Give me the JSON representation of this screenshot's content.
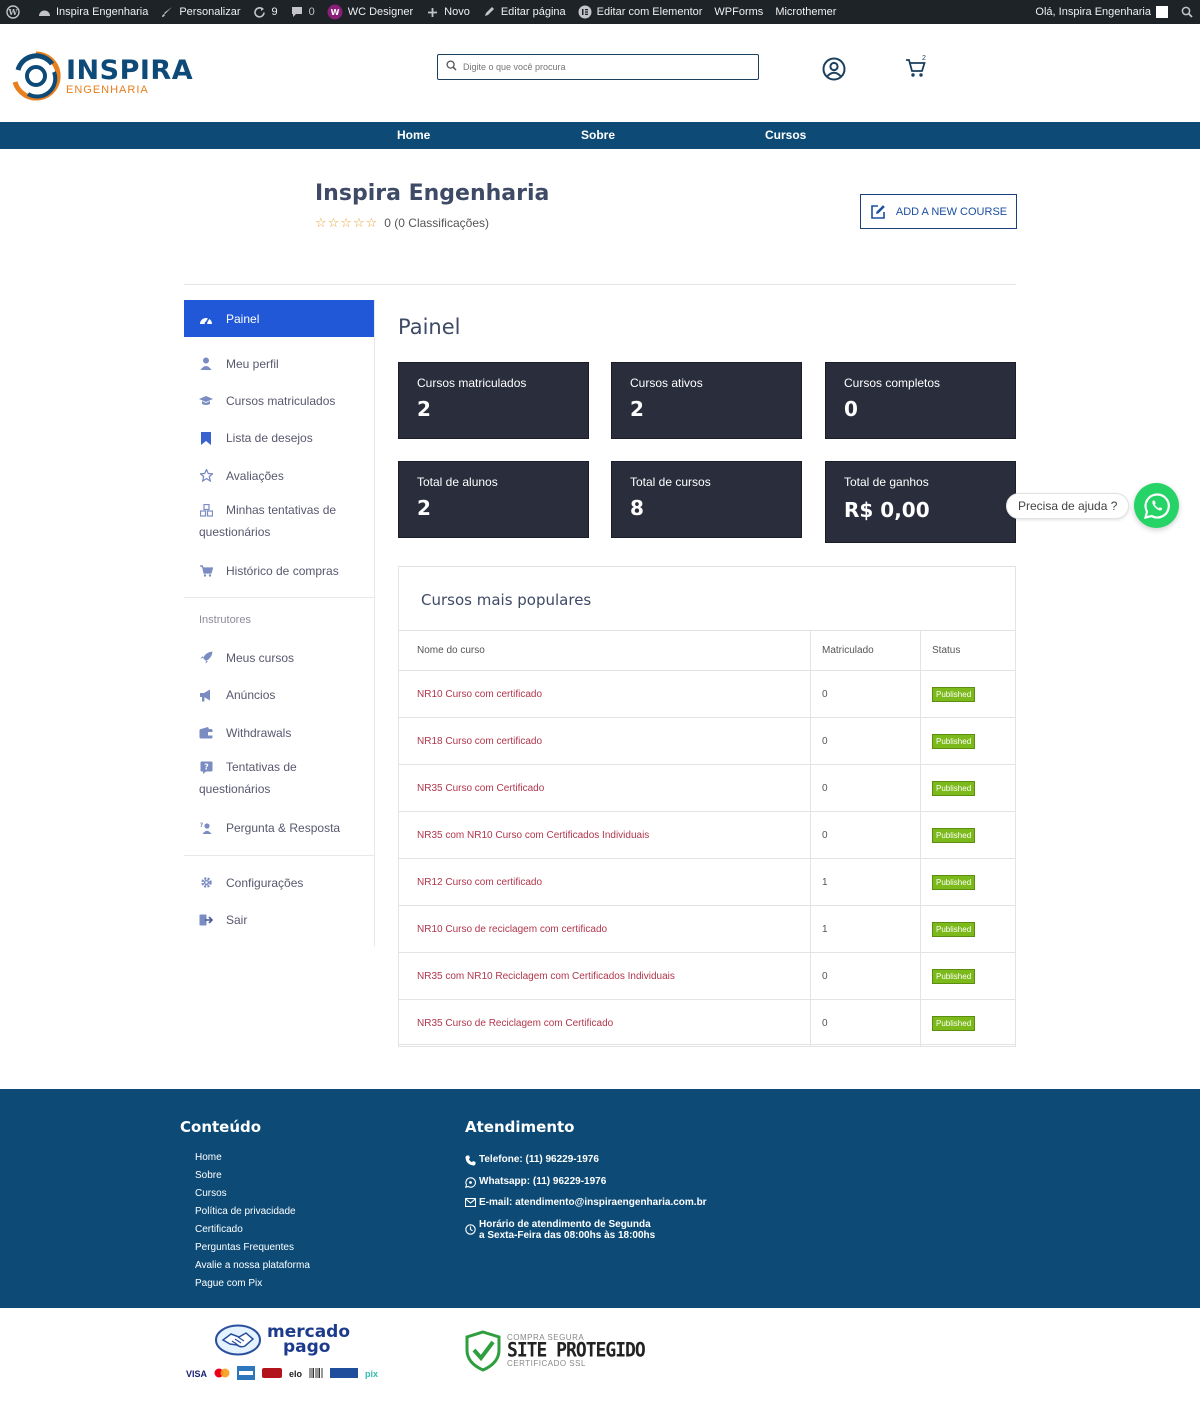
{
  "adminbar": {
    "items": [
      "Inspira Engenharia",
      "Personalizar",
      "9",
      "0",
      "WC Designer",
      "Novo",
      "Editar página",
      "Editar com Elementor",
      "WPForms",
      "Microthemer"
    ],
    "greeting": "Olá, Inspira Engenharia"
  },
  "header": {
    "logo_main": "INSPIRA",
    "logo_sub": "ENGENHARIA",
    "search_placeholder": "Digite o que você procura",
    "cart_count": "2"
  },
  "nav": {
    "items": [
      "Home",
      "Sobre",
      "Cursos"
    ]
  },
  "profile": {
    "name": "Inspira Engenharia",
    "rating_text": "0 (0 Classificações)",
    "add_course": "ADD A NEW COURSE"
  },
  "sidebar": {
    "items": [
      "Painel",
      "Meu perfil",
      "Cursos matriculados",
      "Lista de desejos",
      "Avaliações",
      "Minhas tentativas de",
      "questionários",
      "Histórico de compras"
    ],
    "instructor_heading": "Instrutores",
    "instructor_items": [
      "Meus cursos",
      "Anúncios",
      "Withdrawals",
      "Tentativas de",
      "questionários",
      "Pergunta & Resposta"
    ],
    "bottom_items": [
      "Configurações",
      "Sair"
    ]
  },
  "dashboard": {
    "title": "Painel",
    "cards": [
      {
        "label": "Cursos matriculados",
        "value": "2"
      },
      {
        "label": "Cursos ativos",
        "value": "2"
      },
      {
        "label": "Cursos completos",
        "value": "0"
      },
      {
        "label": "Total de alunos",
        "value": "2"
      },
      {
        "label": "Total de cursos",
        "value": "8"
      },
      {
        "label": "Total de ganhos",
        "value": "R$ 0,00"
      }
    ]
  },
  "popular": {
    "title": "Cursos mais populares",
    "headers": [
      "Nome do curso",
      "Matriculado",
      "Status"
    ],
    "rows": [
      {
        "name": "NR10 Curso com certificado",
        "enrolled": "0",
        "status": "Published"
      },
      {
        "name": "NR18 Curso com certificado",
        "enrolled": "0",
        "status": "Published"
      },
      {
        "name": "NR35 Curso com Certificado",
        "enrolled": "0",
        "status": "Published"
      },
      {
        "name": "NR35 com NR10 Curso com Certificados Individuais",
        "enrolled": "0",
        "status": "Published"
      },
      {
        "name": "NR12 Curso com certificado",
        "enrolled": "1",
        "status": "Published"
      },
      {
        "name": "NR10 Curso de reciclagem com certificado",
        "enrolled": "1",
        "status": "Published"
      },
      {
        "name": "NR35 com NR10 Reciclagem com Certificados Individuais",
        "enrolled": "0",
        "status": "Published"
      },
      {
        "name": "NR35 Curso de Reciclagem com Certificado",
        "enrolled": "0",
        "status": "Published"
      }
    ]
  },
  "whatsapp": {
    "help": "Precisa de ajuda ?"
  },
  "footer": {
    "content_heading": "Conteúdo",
    "links": [
      "Home",
      "Sobre",
      "Cursos",
      "Política de privacidade",
      "Certificado",
      "Perguntas Frequentes",
      "Avalie a nossa plataforma",
      "Pague com Pix"
    ],
    "service_heading": "Atendimento",
    "phone": "Telefone: (11) 96229-1976",
    "whatsapp": "Whatsapp: (11) 96229-1976",
    "email": "E-mail: atendimento@inspiraengenharia.com.br",
    "hours_1": "Horário de atendimento de Segunda",
    "hours_2": "a Sexta-Feira das 08:00hs às 18:00hs"
  },
  "badges": {
    "mp_1": "mercado",
    "mp_2": "pago",
    "pay_methods": [
      "VISA",
      "elo",
      "pix"
    ],
    "seal_top": "COMPRA SEGURA",
    "seal_main": "SITE PROTEGIDO",
    "seal_bottom": "CERTIFICADO SSL"
  },
  "colors": {
    "brand_blue": "#0d4b76",
    "accent_orange": "#e87e1c",
    "active_blue": "#2158d8",
    "card_dark": "#2a2e3c",
    "published_green": "#7cb91b",
    "whatsapp_green": "#25d366"
  }
}
